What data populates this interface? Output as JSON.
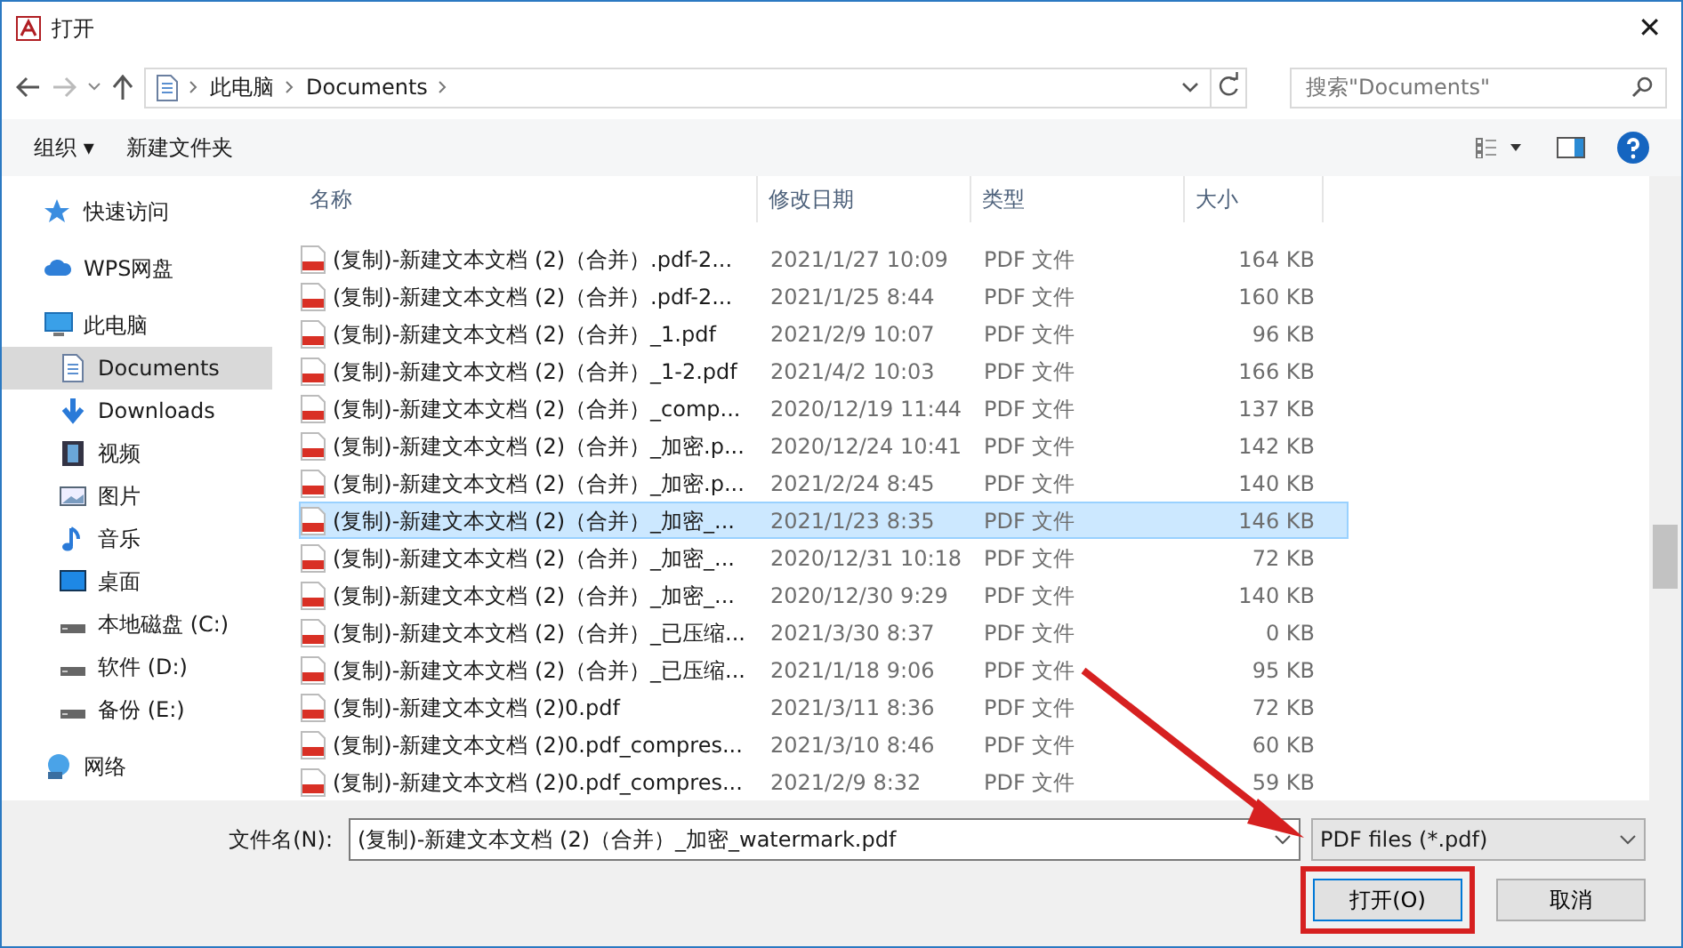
{
  "window": {
    "title": "打开",
    "close": "✕"
  },
  "address": {
    "path": [
      "此电脑",
      "Documents"
    ],
    "search_placeholder": "搜索\"Documents\""
  },
  "toolbar": {
    "organize": "组织 ▾",
    "new_folder": "新建文件夹"
  },
  "sidebar": {
    "items": [
      {
        "label": "快速访问",
        "selected": false
      },
      {
        "label": "WPS网盘",
        "selected": false
      },
      {
        "label": "此电脑",
        "selected": false,
        "children": [
          {
            "label": "Documents",
            "selected": true
          },
          {
            "label": "Downloads",
            "selected": false
          },
          {
            "label": "视频",
            "selected": false
          },
          {
            "label": "图片",
            "selected": false
          },
          {
            "label": "音乐",
            "selected": false
          },
          {
            "label": "桌面",
            "selected": false
          },
          {
            "label": "本地磁盘 (C:)",
            "selected": false
          },
          {
            "label": "软件 (D:)",
            "selected": false
          },
          {
            "label": "备份 (E:)",
            "selected": false
          }
        ]
      },
      {
        "label": "网络",
        "selected": false
      }
    ]
  },
  "table": {
    "columns": [
      "名称",
      "修改日期",
      "类型",
      "大小"
    ],
    "rows": [
      {
        "name": "(复制)-新建文本文档 (2)（合并）.pdf-2...",
        "date": "2021/1/27 10:09",
        "type": "PDF 文件",
        "size": "164 KB",
        "selected": false
      },
      {
        "name": "(复制)-新建文本文档 (2)（合并）.pdf-2...",
        "date": "2021/1/25 8:44",
        "type": "PDF 文件",
        "size": "160 KB",
        "selected": false
      },
      {
        "name": "(复制)-新建文本文档 (2)（合并）_1.pdf",
        "date": "2021/2/9 10:07",
        "type": "PDF 文件",
        "size": "96 KB",
        "selected": false
      },
      {
        "name": "(复制)-新建文本文档 (2)（合并）_1-2.pdf",
        "date": "2021/4/2 10:03",
        "type": "PDF 文件",
        "size": "166 KB",
        "selected": false
      },
      {
        "name": "(复制)-新建文本文档 (2)（合并）_comp...",
        "date": "2020/12/19 11:44",
        "type": "PDF 文件",
        "size": "137 KB",
        "selected": false
      },
      {
        "name": "(复制)-新建文本文档 (2)（合并）_加密.p...",
        "date": "2020/12/24 10:41",
        "type": "PDF 文件",
        "size": "142 KB",
        "selected": false
      },
      {
        "name": "(复制)-新建文本文档 (2)（合并）_加密.p...",
        "date": "2021/2/24 8:45",
        "type": "PDF 文件",
        "size": "140 KB",
        "selected": false
      },
      {
        "name": "(复制)-新建文本文档 (2)（合并）_加密_...",
        "date": "2021/1/23 8:35",
        "type": "PDF 文件",
        "size": "146 KB",
        "selected": true
      },
      {
        "name": "(复制)-新建文本文档 (2)（合并）_加密_...",
        "date": "2020/12/31 10:18",
        "type": "PDF 文件",
        "size": "72 KB",
        "selected": false
      },
      {
        "name": "(复制)-新建文本文档 (2)（合并）_加密_...",
        "date": "2020/12/30 9:29",
        "type": "PDF 文件",
        "size": "140 KB",
        "selected": false
      },
      {
        "name": "(复制)-新建文本文档 (2)（合并）_已压缩...",
        "date": "2021/3/30 8:37",
        "type": "PDF 文件",
        "size": "0 KB",
        "selected": false
      },
      {
        "name": "(复制)-新建文本文档 (2)（合并）_已压缩...",
        "date": "2021/1/18 9:06",
        "type": "PDF 文件",
        "size": "95 KB",
        "selected": false
      },
      {
        "name": "(复制)-新建文本文档 (2)0.pdf",
        "date": "2021/3/11 8:36",
        "type": "PDF 文件",
        "size": "72 KB",
        "selected": false
      },
      {
        "name": "(复制)-新建文本文档 (2)0.pdf_compres...",
        "date": "2021/3/10 8:46",
        "type": "PDF 文件",
        "size": "60 KB",
        "selected": false
      },
      {
        "name": "(复制)-新建文本文档 (2)0.pdf_compres...",
        "date": "2021/2/9 8:32",
        "type": "PDF 文件",
        "size": "59 KB",
        "selected": false
      }
    ]
  },
  "footer": {
    "filename_label": "文件名(N):",
    "filename": "(复制)-新建文本文档 (2)（合并）_加密_watermark.pdf",
    "filter": "PDF files (*.pdf)",
    "open": "打开(O)",
    "cancel": "取消"
  },
  "annotations": {
    "arrow": true,
    "open_button_highlight": true
  }
}
